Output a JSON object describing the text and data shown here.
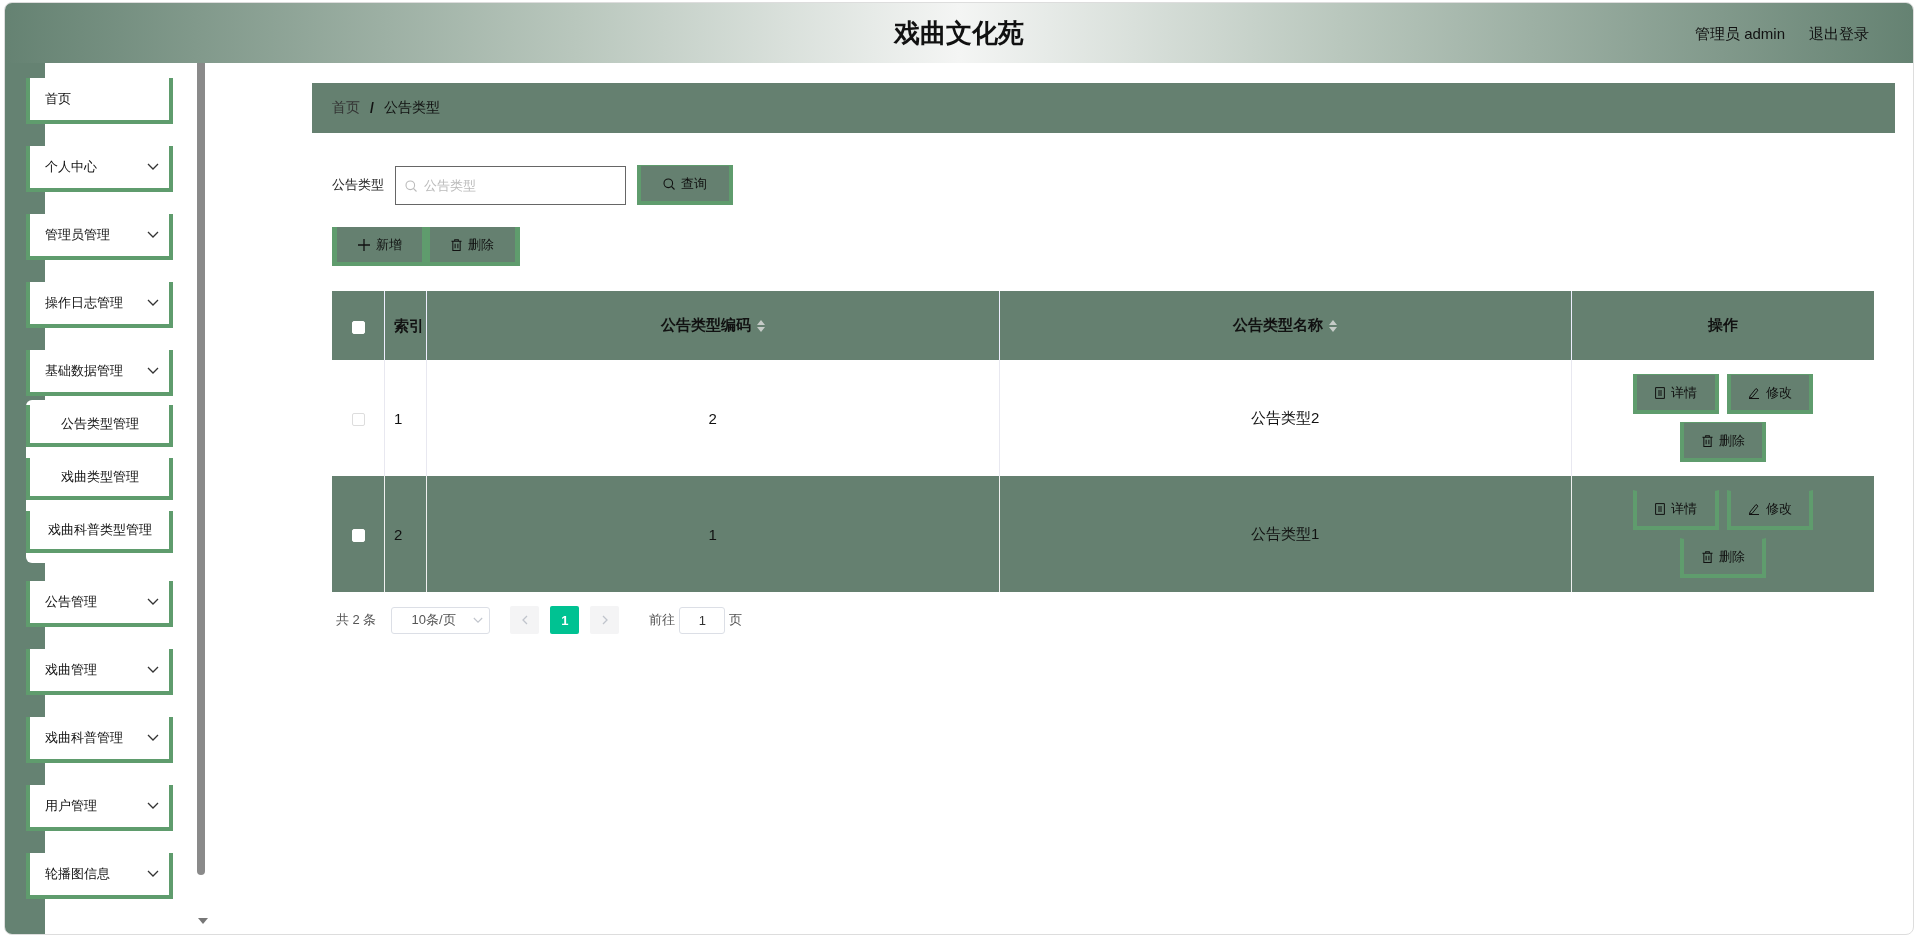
{
  "header": {
    "title": "戏曲文化苑",
    "user": "管理员 admin",
    "logout": "退出登录"
  },
  "sidebar": {
    "items": [
      {
        "label": "首页",
        "kind": "link"
      },
      {
        "label": "个人中心",
        "kind": "menu"
      },
      {
        "label": "管理员管理",
        "kind": "menu"
      },
      {
        "label": "操作日志管理",
        "kind": "menu"
      },
      {
        "label": "基础数据管理",
        "kind": "menu",
        "children": [
          {
            "label": "公告类型管理"
          },
          {
            "label": "戏曲类型管理"
          },
          {
            "label": "戏曲科普类型管理"
          }
        ]
      },
      {
        "label": "公告管理",
        "kind": "menu"
      },
      {
        "label": "戏曲管理",
        "kind": "menu"
      },
      {
        "label": "戏曲科普管理",
        "kind": "menu"
      },
      {
        "label": "用户管理",
        "kind": "menu"
      },
      {
        "label": "轮播图信息",
        "kind": "menu"
      }
    ]
  },
  "breadcrumb": {
    "items": [
      {
        "label": "首页"
      },
      {
        "label": "公告类型"
      }
    ],
    "separator": "/"
  },
  "search": {
    "label": "公告类型",
    "placeholder": "公告类型",
    "button": "查询"
  },
  "actions": [
    {
      "label": "新增",
      "kind": "add"
    },
    {
      "label": "删除",
      "kind": "delete"
    }
  ],
  "table": {
    "columns": [
      {
        "kind": "checkbox",
        "checked": false
      },
      {
        "kind": "index",
        "label": "索引"
      },
      {
        "kind": "text",
        "label": "公告类型编码",
        "sortable": true
      },
      {
        "kind": "text",
        "label": "公告类型名称",
        "sortable": true
      },
      {
        "kind": "actions",
        "label": "操作"
      }
    ],
    "rows": [
      {
        "checked": false,
        "highlighted": false,
        "index": "1",
        "code": "2",
        "name": "公告类型2",
        "actions": [
          {
            "label": "详情",
            "kind": "detail"
          },
          {
            "label": "修改",
            "kind": "edit"
          },
          {
            "label": "删除",
            "kind": "delete"
          }
        ]
      },
      {
        "checked": false,
        "highlighted": true,
        "index": "2",
        "code": "1",
        "name": "公告类型1",
        "actions": [
          {
            "label": "详情",
            "kind": "detail"
          },
          {
            "label": "修改",
            "kind": "edit"
          },
          {
            "label": "删除",
            "kind": "delete"
          }
        ]
      }
    ]
  },
  "pagination": {
    "total": "共 2 条",
    "page_size": "10条/页",
    "pages": [
      {
        "label": "1",
        "selected": true
      }
    ],
    "goto_label": "前往",
    "goto_value": "1",
    "goto_suffix": "页"
  }
}
